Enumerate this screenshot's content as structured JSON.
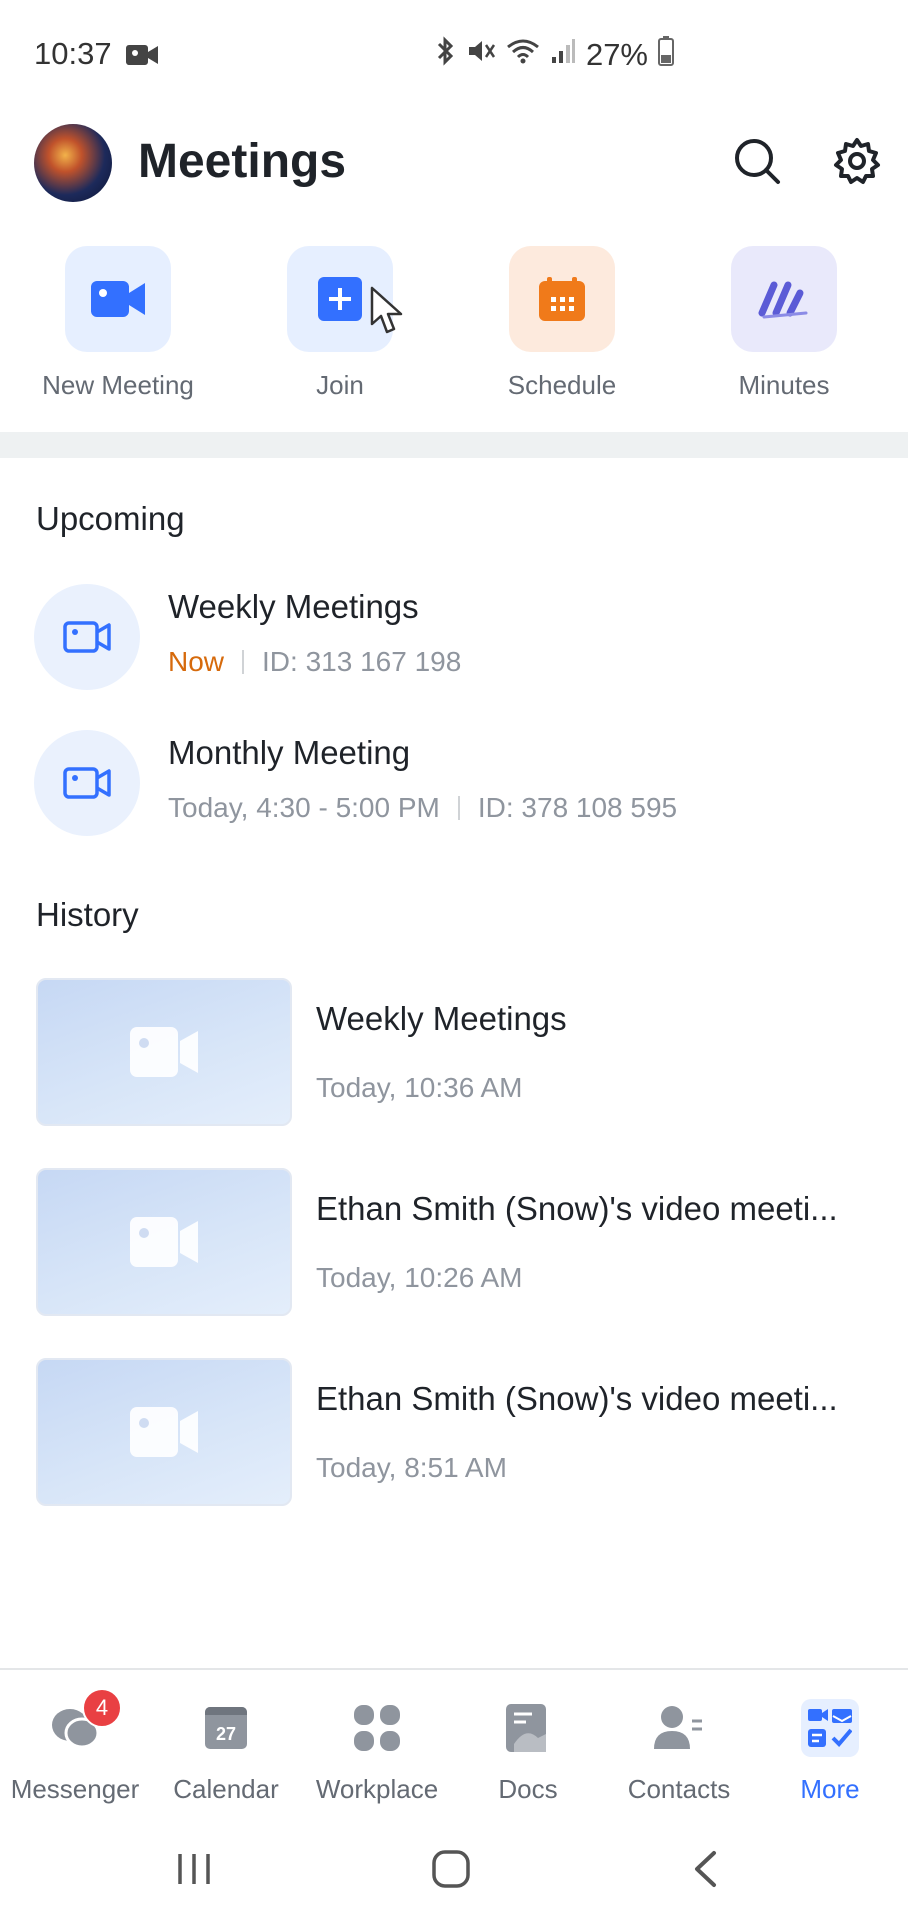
{
  "status_bar": {
    "time": "10:37",
    "battery": "27%"
  },
  "header": {
    "title": "Meetings"
  },
  "actions": [
    {
      "label": "New Meeting"
    },
    {
      "label": "Join"
    },
    {
      "label": "Schedule"
    },
    {
      "label": "Minutes"
    }
  ],
  "upcoming": {
    "heading": "Upcoming",
    "items": [
      {
        "title": "Weekly Meetings",
        "status": "Now",
        "id": "ID: 313 167 198"
      },
      {
        "title": "Monthly Meeting",
        "time": "Today, 4:30 - 5:00 PM",
        "id": "ID: 378 108 595"
      }
    ]
  },
  "history": {
    "heading": "History",
    "items": [
      {
        "title": "Weekly Meetings",
        "time": "Today, 10:36 AM"
      },
      {
        "title": "Ethan Smith (Snow)'s video meeti...",
        "time": "Today, 10:26 AM"
      },
      {
        "title": "Ethan Smith (Snow)'s video meeti...",
        "time": "Today, 8:51 AM"
      }
    ]
  },
  "tabbar": {
    "messenger_badge": "4",
    "calendar_day": "27",
    "tabs": [
      {
        "label": "Messenger"
      },
      {
        "label": "Calendar"
      },
      {
        "label": "Workplace"
      },
      {
        "label": "Docs"
      },
      {
        "label": "Contacts"
      },
      {
        "label": "More"
      }
    ]
  },
  "colors": {
    "accent": "#3370ff",
    "now": "#d66a0c",
    "schedule": "#f07a1a",
    "minutes": "#5b5bd6"
  }
}
